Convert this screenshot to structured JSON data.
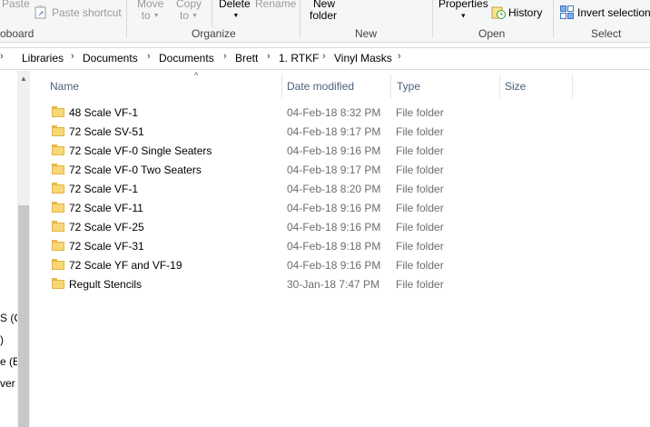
{
  "ribbon": {
    "clipboard": {
      "paste_label": "Paste",
      "paste_shortcut_label": "Paste shortcut",
      "group_label": "oboard"
    },
    "organize": {
      "move_to_line1": "Move",
      "move_to_line2": "to",
      "copy_to_line1": "Copy",
      "copy_to_line2": "to",
      "delete_label": "Delete",
      "rename_label": "Rename",
      "group_label": "Organize"
    },
    "new": {
      "new_folder_line1": "New",
      "new_folder_line2": "folder",
      "group_label": "New"
    },
    "open": {
      "properties_label": "Properties",
      "history_label": "History",
      "group_label": "Open"
    },
    "select": {
      "invert_selection_label": "Invert selection",
      "group_label": "Select"
    }
  },
  "address": {
    "crumbs": [
      "Libraries",
      "Documents",
      "Documents",
      "Brett",
      "1. RTKF",
      "Vinyl Masks"
    ]
  },
  "navpane": {
    "partial_items": [
      "S (C",
      ")",
      "e (E",
      "ver"
    ]
  },
  "columns": {
    "name": "Name",
    "date": "Date modified",
    "type": "Type",
    "size": "Size"
  },
  "files": [
    {
      "name": "48 Scale VF-1",
      "date": "04-Feb-18 8:32 PM",
      "type": "File folder"
    },
    {
      "name": "72 Scale SV-51",
      "date": "04-Feb-18 9:17 PM",
      "type": "File folder"
    },
    {
      "name": "72 Scale VF-0 Single Seaters",
      "date": "04-Feb-18 9:16 PM",
      "type": "File folder"
    },
    {
      "name": "72 Scale VF-0 Two Seaters",
      "date": "04-Feb-18 9:17 PM",
      "type": "File folder"
    },
    {
      "name": "72 Scale VF-1",
      "date": "04-Feb-18 8:20 PM",
      "type": "File folder"
    },
    {
      "name": "72 Scale VF-11",
      "date": "04-Feb-18 9:16 PM",
      "type": "File folder"
    },
    {
      "name": "72 Scale VF-25",
      "date": "04-Feb-18 9:16 PM",
      "type": "File folder"
    },
    {
      "name": "72 Scale VF-31",
      "date": "04-Feb-18 9:18 PM",
      "type": "File folder"
    },
    {
      "name": "72 Scale YF and VF-19",
      "date": "04-Feb-18 9:16 PM",
      "type": "File folder"
    },
    {
      "name": "Regult Stencils",
      "date": "30-Jan-18 7:47 PM",
      "type": "File folder"
    }
  ],
  "colors": {
    "folder_fill": "#f8d775",
    "header_text": "#4c607a",
    "meta_text": "#6d6d6d"
  }
}
